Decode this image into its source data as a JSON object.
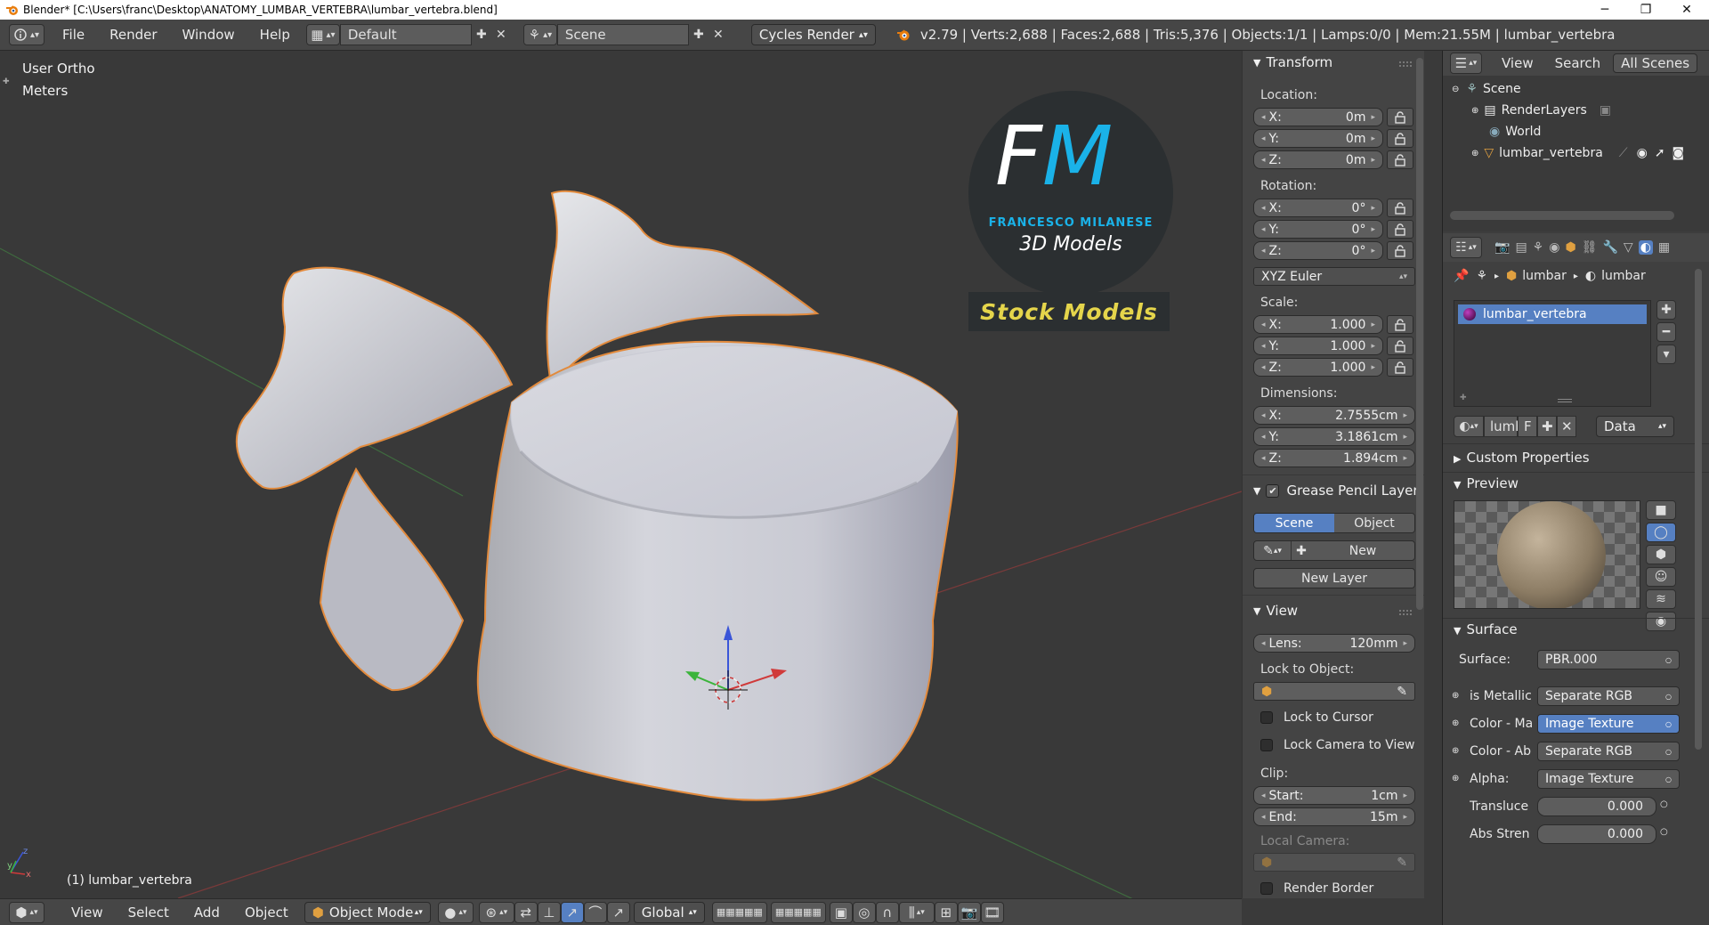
{
  "window": {
    "title": "Blender* [C:\\Users\\franc\\Desktop\\ANATOMY_LUMBAR_VERTEBRA\\lumbar_vertebra.blend]"
  },
  "topbar": {
    "menus": [
      "File",
      "Render",
      "Window",
      "Help"
    ],
    "screen_layout": "Default",
    "scene": "Scene",
    "render_engine": "Cycles Render",
    "stats": "v2.79 | Verts:2,688 | Faces:2,688 | Tris:5,376 | Objects:1/1 | Lamps:0/0 | Mem:21.55M | lumbar_vertebra"
  },
  "viewport": {
    "view_name": "User Ortho",
    "units": "Meters",
    "object_label": "(1) lumbar_vertebra",
    "logo": {
      "letter_f": "F",
      "letter_m": "M",
      "brand": "FRANCESCO MILANESE",
      "tagline": "3D Models",
      "stock": "Stock Models"
    }
  },
  "npanel": {
    "transform": {
      "header": "Transform",
      "location_label": "Location:",
      "location": [
        {
          "axis": "X:",
          "value": "0m"
        },
        {
          "axis": "Y:",
          "value": "0m"
        },
        {
          "axis": "Z:",
          "value": "0m"
        }
      ],
      "rotation_label": "Rotation:",
      "rotation": [
        {
          "axis": "X:",
          "value": "0°"
        },
        {
          "axis": "Y:",
          "value": "0°"
        },
        {
          "axis": "Z:",
          "value": "0°"
        }
      ],
      "rotation_mode": "XYZ Euler",
      "scale_label": "Scale:",
      "scale": [
        {
          "axis": "X:",
          "value": "1.000"
        },
        {
          "axis": "Y:",
          "value": "1.000"
        },
        {
          "axis": "Z:",
          "value": "1.000"
        }
      ],
      "dimensions_label": "Dimensions:",
      "dimensions": [
        {
          "axis": "X:",
          "value": "2.7555cm"
        },
        {
          "axis": "Y:",
          "value": "3.1861cm"
        },
        {
          "axis": "Z:",
          "value": "1.894cm"
        }
      ]
    },
    "grease_pencil": {
      "header": "Grease Pencil Layer",
      "tab_scene": "Scene",
      "tab_object": "Object",
      "new_label": "New",
      "new_layer_label": "New Layer"
    },
    "view": {
      "header": "View",
      "lens_label": "Lens:",
      "lens_value": "120mm",
      "lock_object_label": "Lock to Object:",
      "lock_cursor_label": "Lock to Cursor",
      "lock_camera_label": "Lock Camera to View",
      "clip_label": "Clip:",
      "clip_start_label": "Start:",
      "clip_start_value": "1cm",
      "clip_end_label": "End:",
      "clip_end_value": "15m",
      "local_camera_label": "Local Camera:",
      "render_border_label": "Render Border"
    }
  },
  "outliner": {
    "menu_view": "View",
    "menu_search": "Search",
    "filter": "All Scenes",
    "rows": [
      "Scene",
      "RenderLayers",
      "World",
      "lumbar_vertebra"
    ]
  },
  "properties": {
    "breadcrumb_object": "lumbar",
    "breadcrumb_material": "lumbar",
    "material_slot": "lumbar_vertebra",
    "material_name": "lumb",
    "fake_user": "F",
    "link_mode": "Data",
    "custom_props_header": "Custom Properties",
    "preview_header": "Preview",
    "surface_header": "Surface",
    "surface_label": "Surface:",
    "surface_value": "PBR.000",
    "inputs": [
      {
        "label": "is Metallic",
        "value": "Separate RGB"
      },
      {
        "label": "Color - Ma",
        "value": "Image Texture"
      },
      {
        "label": "Color - Ab",
        "value": "Separate RGB"
      },
      {
        "label": "Alpha:",
        "value": "Image Texture"
      }
    ],
    "sliders": [
      {
        "label": "Transluce",
        "value": "0.000"
      },
      {
        "label": "Abs Stren",
        "value": "0.000"
      }
    ]
  },
  "bottombar": {
    "menus": [
      "View",
      "Select",
      "Add",
      "Object"
    ],
    "mode": "Object Mode",
    "orientation": "Global"
  },
  "colors": {
    "accent_blue": "#5680c2",
    "logo_cyan": "#1ab2e8",
    "logo_yellow": "#e5d54b",
    "selection_outline": "#e28a3c"
  }
}
